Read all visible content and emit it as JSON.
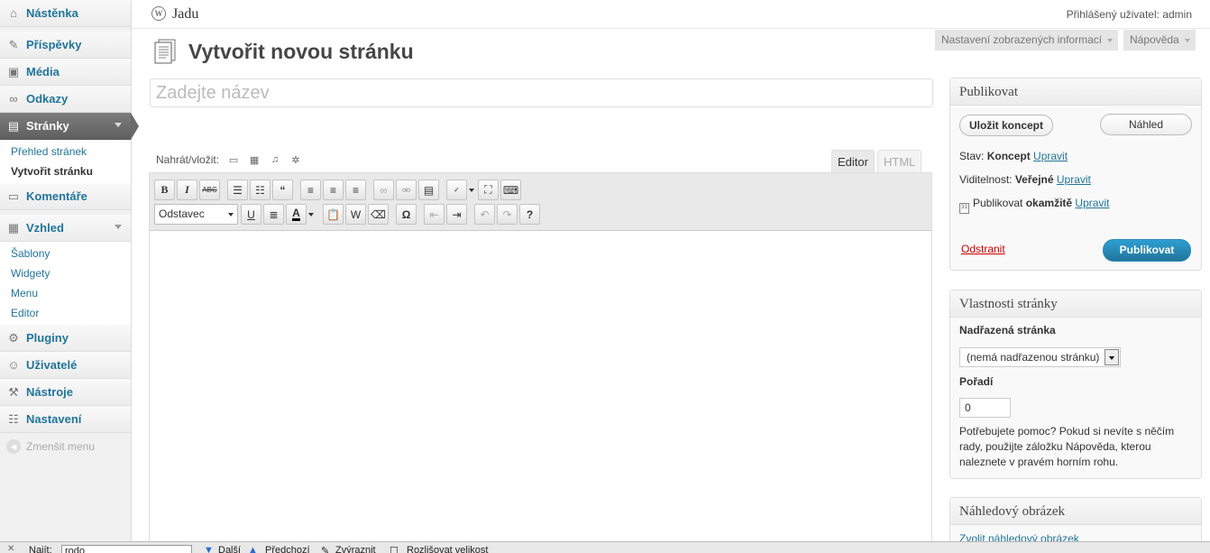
{
  "sidebar": {
    "dashboard": "Nástěnka",
    "posts": "Příspěvky",
    "media": "Média",
    "links": "Odkazy",
    "pages": "Stránky",
    "pages_sub": [
      "Přehled stránek",
      "Vytvořit stránku"
    ],
    "comments": "Komentáře",
    "appearance": "Vzhled",
    "appearance_sub": [
      "Šablony",
      "Widgety",
      "Menu",
      "Editor"
    ],
    "plugins": "Pluginy",
    "users": "Uživatelé",
    "tools": "Nástroje",
    "settings": "Nastavení",
    "collapse": "Zmenšit menu"
  },
  "header": {
    "site_name": "Jadu",
    "user_label": "Přihlášený uživatel:",
    "user_name": "admin",
    "screen_options": "Nastavení zobrazených informací",
    "help": "Nápověda"
  },
  "main": {
    "title": "Vytvořit novou stránku",
    "title_placeholder": "Zadejte název",
    "upload_label": "Nahrát/vložit:",
    "tab_editor": "Editor",
    "tab_html": "HTML",
    "format_select": "Odstavec"
  },
  "publish": {
    "heading": "Publikovat",
    "save_draft": "Uložit koncept",
    "preview": "Náhled",
    "status_label": "Stav:",
    "status_value": "Koncept",
    "visibility_label": "Viditelnost:",
    "visibility_value": "Veřejné",
    "publish_label": "Publikovat",
    "publish_value": "okamžitě",
    "edit": "Upravit",
    "trash": "Odstranit",
    "publish_button": "Publikovat"
  },
  "attributes": {
    "heading": "Vlastnosti stránky",
    "parent_label": "Nadřazená stránka",
    "parent_value": "(nemá nadřazenou stránku)",
    "order_label": "Pořadí",
    "order_value": "0",
    "help": "Potřebujete pomoc? Pokud si nevíte s něčím rady, použijte záložku Nápověda, kterou naleznete v pravém horním rohu."
  },
  "featured": {
    "heading": "Náhledový obrázek",
    "link": "Zvolit náhledový obrázek"
  },
  "findbar": {
    "close": "✕",
    "label": "Najít:",
    "value": "rodo",
    "next": "Další",
    "previous": "Předchozí",
    "highlight": "Zvýraznit",
    "match_case": "Rozlišovat velikost"
  },
  "colors": {
    "link": "#21759b",
    "publish_button": "#21759b",
    "trash": "#cc0000",
    "menu_current": "#6d6d6d"
  }
}
